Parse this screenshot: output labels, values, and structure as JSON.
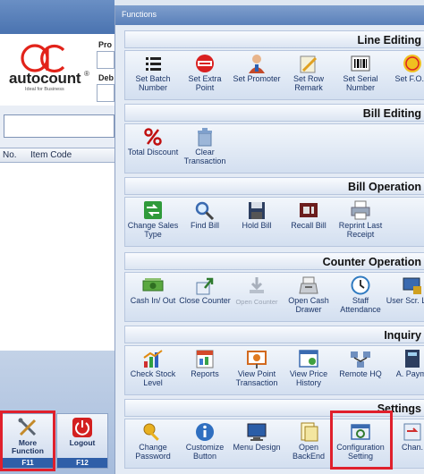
{
  "pos_panel": {
    "brand": "autocount",
    "registered": "®",
    "tagline": "Ideal for Business",
    "field_label_1": "Pro",
    "field_label_2": "Deb",
    "grid_columns": [
      "No.",
      "Item Code"
    ],
    "function_keys": [
      {
        "label": "More Function",
        "key": "F11"
      },
      {
        "label": "Logout",
        "key": "F12"
      }
    ]
  },
  "window": {
    "title": "Functions",
    "groups": [
      {
        "title": "Line Editing",
        "buttons": [
          {
            "label": "Set Batch Number",
            "icon": "list-icon"
          },
          {
            "label": "Set Extra Point",
            "icon": "point-badge-icon"
          },
          {
            "label": "Set Promoter",
            "icon": "person-icon"
          },
          {
            "label": "Set Row Remark",
            "icon": "note-pencil-icon"
          },
          {
            "label": "Set Serial Number",
            "icon": "barcode-icon"
          },
          {
            "label": "Set F.O.C",
            "icon": "free-badge-icon"
          }
        ]
      },
      {
        "title": "Bill Editing",
        "buttons": [
          {
            "label": "Total Discount",
            "icon": "percent-icon"
          },
          {
            "label": "Clear Transaction",
            "icon": "trash-icon"
          }
        ]
      },
      {
        "title": "Bill Operation",
        "buttons": [
          {
            "label": "Change Sales Type",
            "icon": "exchange-icon"
          },
          {
            "label": "Find Bill",
            "icon": "magnifier-icon"
          },
          {
            "label": "Hold Bill",
            "icon": "floppy-icon"
          },
          {
            "label": "Recall Bill",
            "icon": "film-end-icon"
          },
          {
            "label": "Reprint Last Receipt",
            "icon": "printer-icon"
          }
        ]
      },
      {
        "title": "Counter Operation",
        "buttons": [
          {
            "label": "Cash In/ Out",
            "icon": "cash-icon"
          },
          {
            "label": "Close Counter",
            "icon": "export-arrow-icon"
          },
          {
            "label": "Open Counter",
            "icon": "download-arrow-icon",
            "disabled": true
          },
          {
            "label": "Open Cash Drawer",
            "icon": "cash-register-icon"
          },
          {
            "label": "Staff Attendance",
            "icon": "clock-icon"
          },
          {
            "label": "User Scr. Lock",
            "icon": "screen-lock-icon"
          }
        ]
      },
      {
        "title": "Inquiry",
        "buttons": [
          {
            "label": "Check Stock Level",
            "icon": "stock-chart-icon"
          },
          {
            "label": "Reports",
            "icon": "report-icon"
          },
          {
            "label": "View Point Transaction",
            "icon": "presentation-icon"
          },
          {
            "label": "View Price History",
            "icon": "price-window-icon"
          },
          {
            "label": "Remote HQ",
            "icon": "network-icon"
          },
          {
            "label": "A. Paym.",
            "icon": "payment-icon"
          }
        ]
      },
      {
        "title": "Settings",
        "buttons": [
          {
            "label": "Change Password",
            "icon": "key-icon"
          },
          {
            "label": "Customize Button",
            "icon": "info-icon"
          },
          {
            "label": "Menu Design",
            "icon": "monitor-icon"
          },
          {
            "label": "Open BackEnd",
            "icon": "backend-doc-icon"
          },
          {
            "label": "Configuration Setting",
            "icon": "configuration-icon"
          },
          {
            "label": "Chan.",
            "icon": "change-icon"
          }
        ]
      }
    ]
  },
  "colors": {
    "highlight": "#e0202c",
    "accent": "#2f5fa8"
  }
}
